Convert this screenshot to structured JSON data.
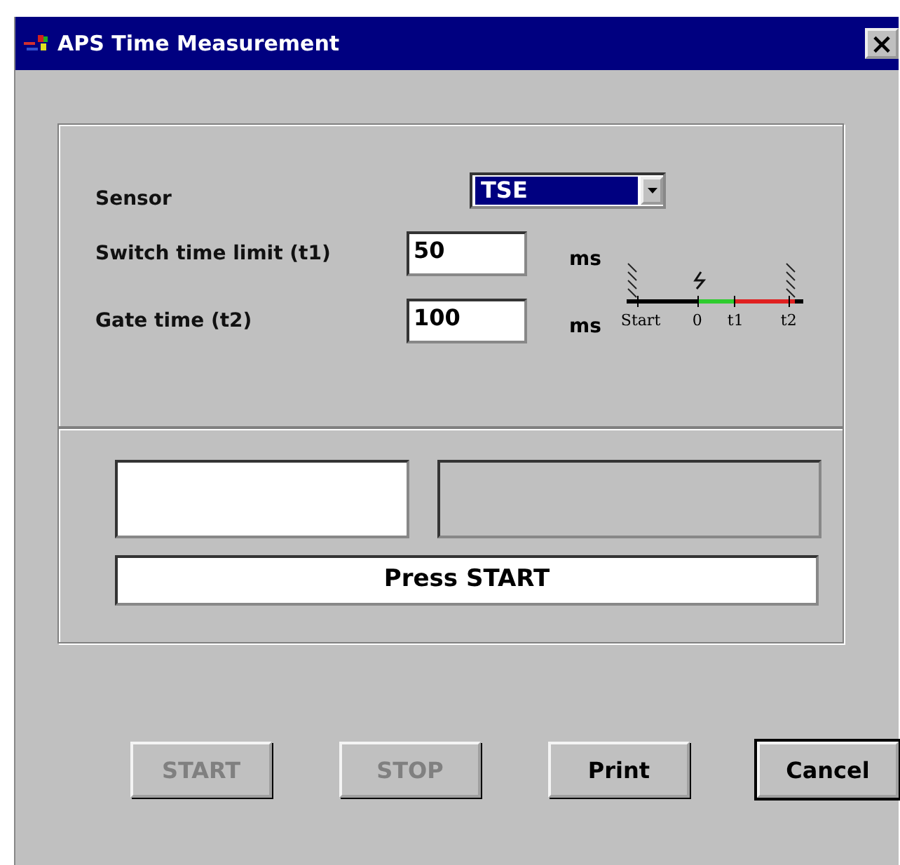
{
  "window": {
    "title": "APS Time Measurement",
    "close": "×"
  },
  "settings": {
    "sensor_label": "Sensor",
    "sensor_value": "TSE",
    "fields": [
      {
        "label": "Switch time limit (t1)",
        "value": "50",
        "unit": "ms"
      },
      {
        "label": "Gate time (t2)",
        "value": "100",
        "unit": "ms"
      }
    ],
    "timeline_labels": [
      "Start",
      "0",
      "t1",
      "t2"
    ]
  },
  "status": {
    "message": "Press START"
  },
  "buttons": [
    {
      "label": "START",
      "disabled": true,
      "default": false
    },
    {
      "label": "STOP",
      "disabled": true,
      "default": false
    },
    {
      "label": "Print",
      "disabled": false,
      "default": false
    },
    {
      "label": "Cancel",
      "disabled": false,
      "default": true
    }
  ]
}
